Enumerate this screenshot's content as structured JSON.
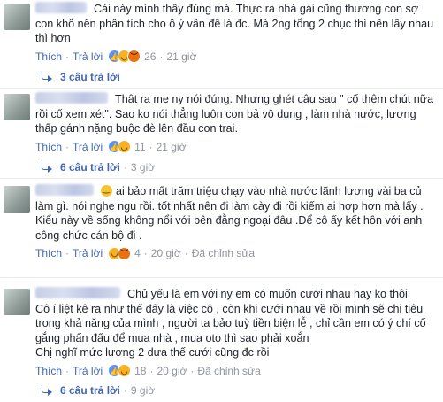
{
  "comments": [
    {
      "text": "Cái này mình thấy đúng mà. Thực ra nhà gái cũng thương con sợ con khổ nên phân tích cho ô ý vấn đề là đc. Mà 2ng tổng 2 chục thì nên lấy nhau thì hơn",
      "like_label": "Thích",
      "reply_label": "Trả lời",
      "reaction_count": "26",
      "time": "21 giờ",
      "replies_label": "3 câu trả lời"
    },
    {
      "text": "Thật ra mẹ ny nói đúng. Nhưng ghét câu sau \" cố thêm chút nữa rồi cố xem xét\". Sao ko nói thẳng luôn con bả vô dụng , làm nhà nước, lương thấp gánh nặng buộc đè lên đầu con trai.",
      "like_label": "Thích",
      "reply_label": "Trả lời",
      "reaction_count": "11",
      "time": "21 giờ",
      "replies_label": "6 câu trả lời",
      "replies_time": "3 giờ"
    },
    {
      "text": "ai bảo mất trăm triệu chạy vào nhà nước lãnh lương vài ba củ làm gì. nói nghe ngu rồi. tốt nhất nên đi làm cày đi rồi kiếm ai hợp hơn mà lấy . Kiểu này về sống không nổi với bên đằng ngoại đâu .Để cô ấy kết hôn với anh công chức cán bộ đi .",
      "like_label": "Thích",
      "reply_label": "Trả lời",
      "reaction_count": "4",
      "time": "20 giờ",
      "edited_label": "Đã chỉnh sửa"
    },
    {
      "text": "Chủ yếu là em với ny em có muốn cưới nhau hay ko thôi\nCô í liệt kê ra như thế đấy là việc cô , còn khi cưới nhau về rồi mình sẽ chi tiêu trong khả năng của mình , người ta bảo tuỳ tiền biện lễ , chỉ cần em có ý chí cố gắng phấn đấu để mua nhà , mua oto thì sao phải xoắn\nChị nghĩ mức lương 2 dưa thế cưới cũng đc rồi",
      "like_label": "Thích",
      "reply_label": "Trả lời",
      "reaction_count": "18",
      "time": "20 giờ",
      "edited_label": "Đã chỉnh sửa",
      "replies_label": "6 câu trả lời",
      "replies_time": "9 giờ"
    }
  ],
  "reactions": [
    "like",
    "haha",
    "wow",
    "angry"
  ]
}
